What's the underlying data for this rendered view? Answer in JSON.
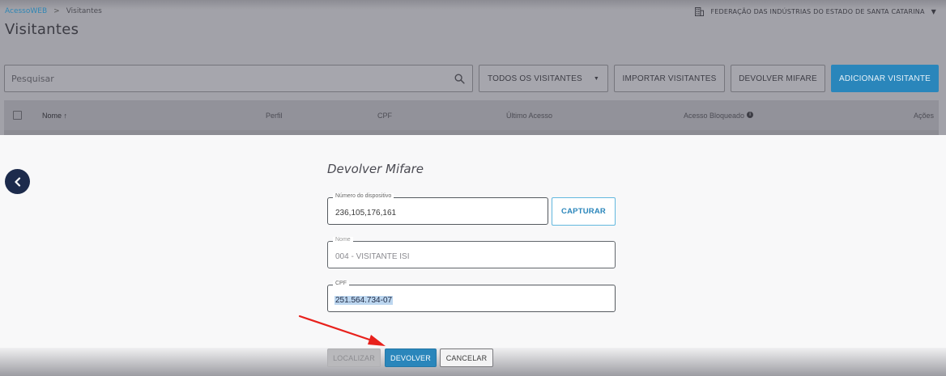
{
  "header": {
    "breadcrumb": {
      "root": "AcessoWEB",
      "separator": ">",
      "current": "Visitantes"
    },
    "page_title": "Visitantes",
    "organization": "FEDERAÇÃO DAS INDÚSTRIAS DO ESTADO DE SANTA CATARINA"
  },
  "toolbar": {
    "search_placeholder": "Pesquisar",
    "filter_label": "TODOS OS VISITANTES",
    "import_label": "IMPORTAR VISITANTES",
    "return_mifare_label": "DEVOLVER MIFARE",
    "add_visitor_label": "ADICIONAR VISITANTE"
  },
  "table": {
    "columns": {
      "nome": "Nome ↑",
      "perfil": "Perfil",
      "cpf": "CPF",
      "ultimo_acesso": "Último Acesso",
      "acesso_bloqueado": "Acesso Bloqueado",
      "acoes": "Ações"
    }
  },
  "modal": {
    "title": "Devolver Mifare",
    "device_field": {
      "label": "Número do dispositivo",
      "value": "236,105,176,161"
    },
    "capture_label": "CAPTURAR",
    "name_field": {
      "label": "Nome",
      "value": "004 - VISITANTE ISI"
    },
    "cpf_field": {
      "label": "CPF",
      "value": "251.564.734-07"
    },
    "actions": {
      "locate": "LOCALIZAR",
      "return": "DEVOLVER",
      "cancel": "CANCELAR"
    }
  },
  "colors": {
    "accent": "#2a86bb",
    "back_button": "#1d2b4c",
    "annotation_arrow": "#e8211c",
    "selection_highlight": "#bcd6ef"
  },
  "icons": {
    "search": "search-icon",
    "organization": "building-icon",
    "back": "chevron-left-icon",
    "info": "info-icon"
  }
}
